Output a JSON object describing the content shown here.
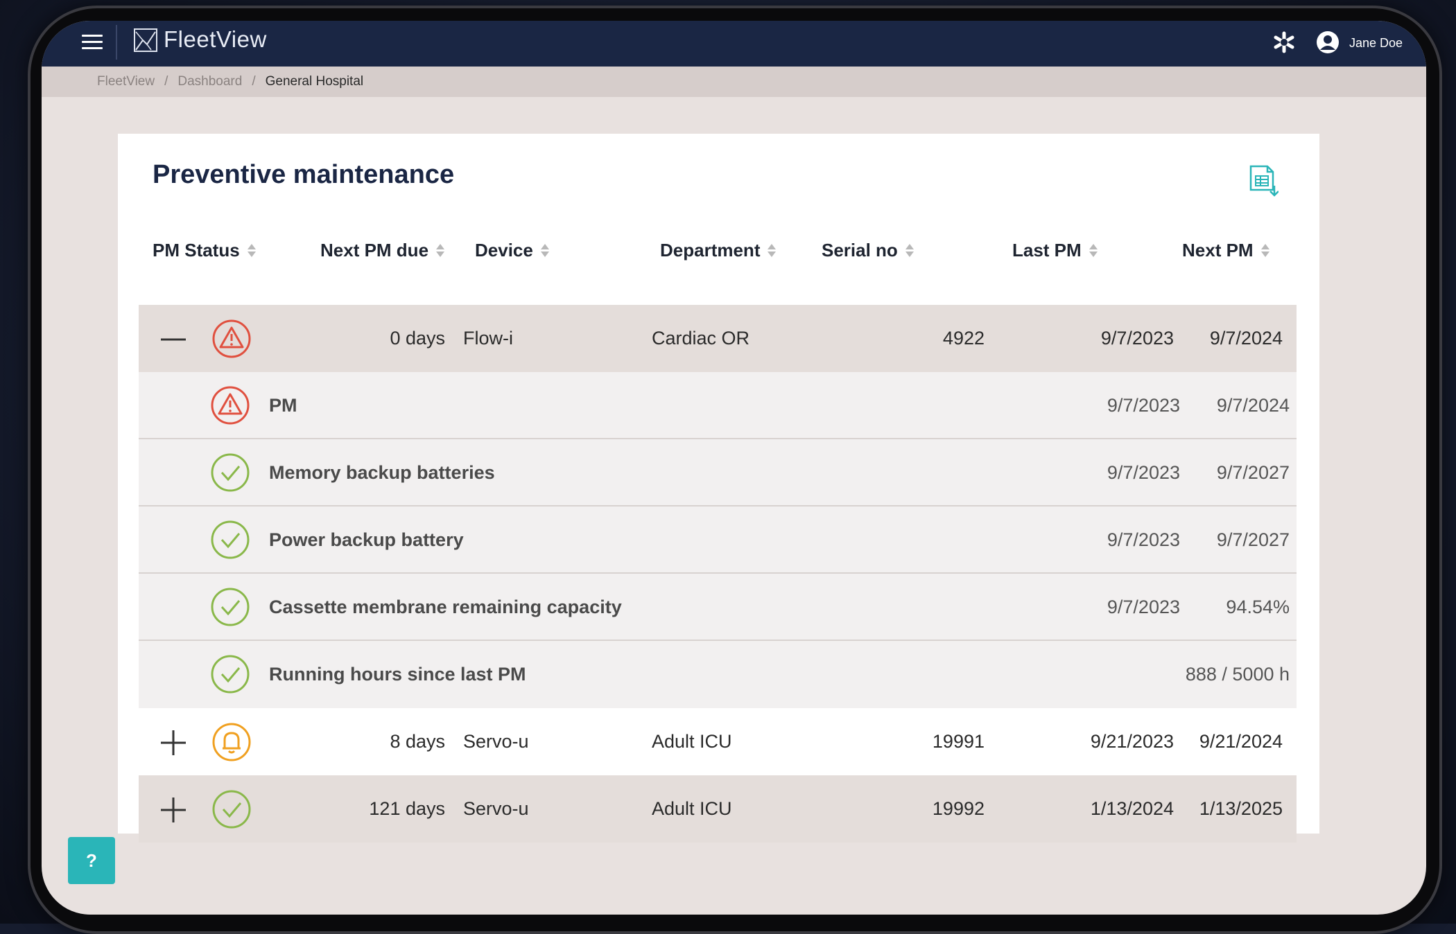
{
  "app": {
    "name": "FleetView"
  },
  "header": {
    "user_name": "Jane Doe"
  },
  "breadcrumb": {
    "items": [
      "FleetView",
      "Dashboard",
      "General Hospital"
    ],
    "separator": "/"
  },
  "card": {
    "title": "Preventive maintenance"
  },
  "table": {
    "columns": [
      "PM Status",
      "Next PM due",
      "Device",
      "Department",
      "Serial no",
      "Last PM",
      "Next PM"
    ],
    "rows": [
      {
        "expanded": true,
        "status": "warning",
        "next_pm_due": "0 days",
        "device": "Flow-i",
        "department": "Cardiac OR",
        "serial": "4922",
        "last_pm": "9/7/2023",
        "next_pm": "9/7/2024"
      },
      {
        "expanded": false,
        "status": "notice",
        "next_pm_due": "8 days",
        "device": "Servo-u",
        "department": "Adult ICU",
        "serial": "19991",
        "last_pm": "9/21/2023",
        "next_pm": "9/21/2024"
      },
      {
        "expanded": false,
        "status": "ok",
        "next_pm_due": "121 days",
        "device": "Servo-u",
        "department": "Adult ICU",
        "serial": "19992",
        "last_pm": "1/13/2024",
        "next_pm": "1/13/2025"
      }
    ],
    "sub_rows": [
      {
        "status": "warning",
        "label": "PM",
        "last": "9/7/2023",
        "next": "9/7/2024"
      },
      {
        "status": "ok",
        "label": "Memory backup batteries",
        "last": "9/7/2023",
        "next": "9/7/2027"
      },
      {
        "status": "ok",
        "label": "Power backup battery",
        "last": "9/7/2023",
        "next": "9/7/2027"
      },
      {
        "status": "ok",
        "label": "Cassette membrane remaining capacity",
        "last": "9/7/2023",
        "next": "94.54%"
      },
      {
        "status": "ok",
        "label": "Running hours since last PM",
        "last": "",
        "next": "888 / 5000 h"
      }
    ]
  },
  "help": {
    "label": "?"
  },
  "colors": {
    "topbar": "#1a2644",
    "warning": "#e0503f",
    "notice": "#f0a020",
    "ok": "#8ab84a",
    "accent": "#2ab5b8"
  }
}
